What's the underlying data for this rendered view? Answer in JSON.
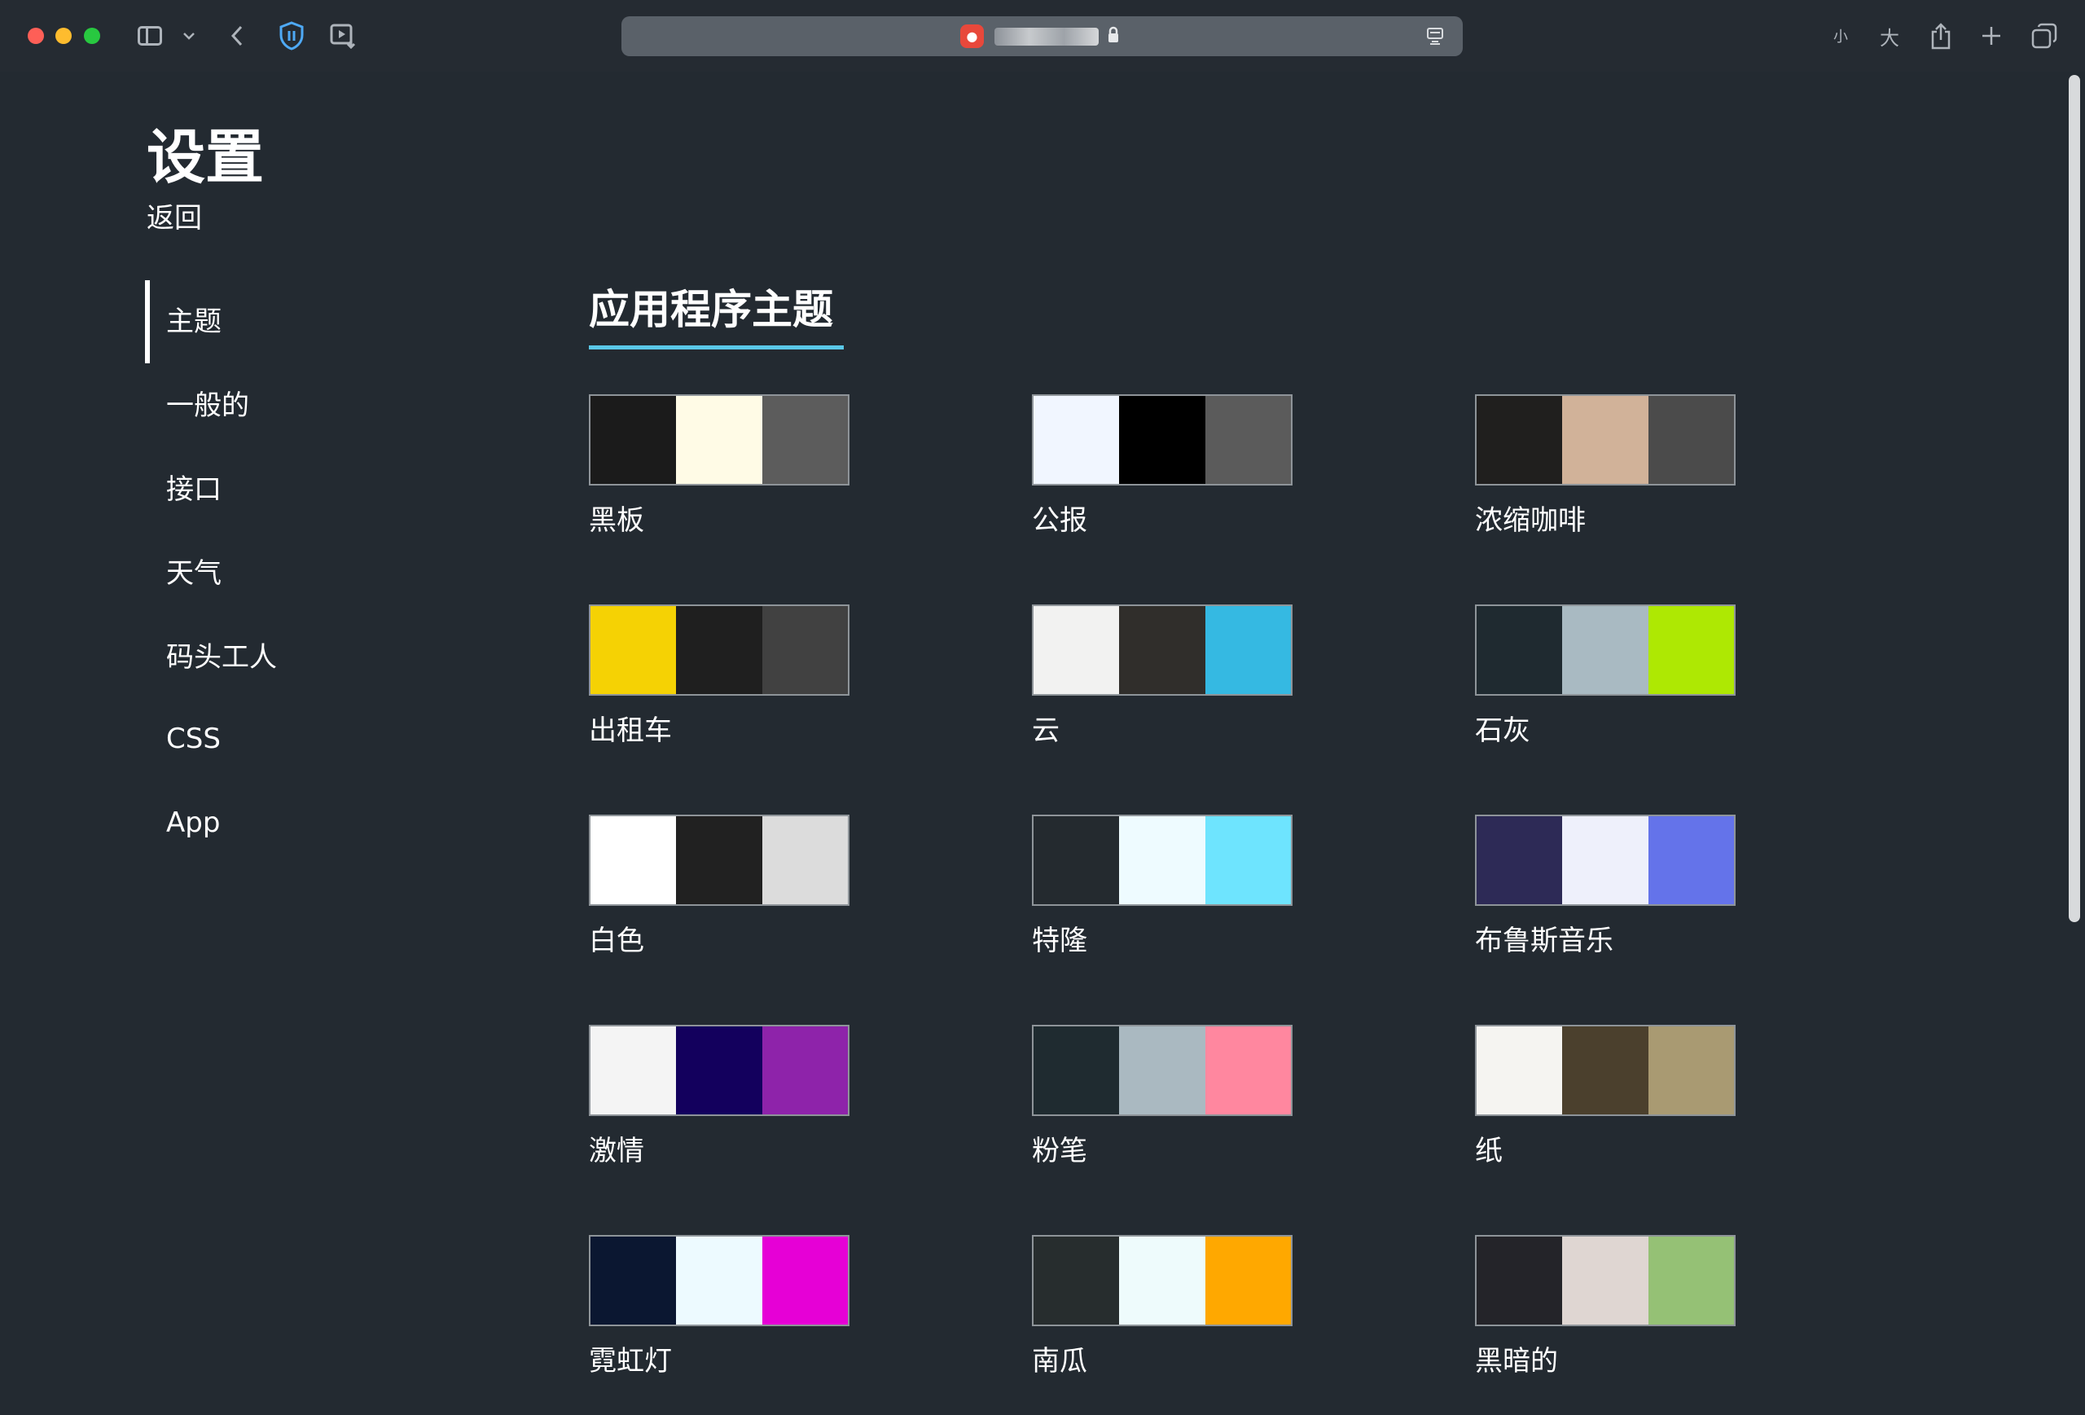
{
  "browser": {
    "font_small_label": "小",
    "font_large_label": "大"
  },
  "page": {
    "title": "设置",
    "back_label": "返回"
  },
  "nav": {
    "items": [
      {
        "label": "主题",
        "active": true
      },
      {
        "label": "一般的",
        "active": false
      },
      {
        "label": "接口",
        "active": false
      },
      {
        "label": "天气",
        "active": false
      },
      {
        "label": "码头工人",
        "active": false
      },
      {
        "label": "CSS",
        "active": false
      },
      {
        "label": "App",
        "active": false
      }
    ]
  },
  "section": {
    "title": "应用程序主题",
    "accent_color": "#5ac8e8"
  },
  "themes": [
    {
      "name": "黑板",
      "colors": [
        "#1b1b1b",
        "#fffbe6",
        "#5c5c5c"
      ]
    },
    {
      "name": "公报",
      "colors": [
        "#f1f6ff",
        "#000000",
        "#5b5b5b"
      ]
    },
    {
      "name": "浓缩咖啡",
      "colors": [
        "#201f1e",
        "#d1b299",
        "#4b4b4b"
      ]
    },
    {
      "name": "出租车",
      "colors": [
        "#f5d204",
        "#1f1f1f",
        "#414141"
      ]
    },
    {
      "name": "云",
      "colors": [
        "#f2f2f1",
        "#302e2b",
        "#35b9e2"
      ]
    },
    {
      "name": "石灰",
      "colors": [
        "#1f2a30",
        "#a9bac2",
        "#aee803"
      ]
    },
    {
      "name": "白色",
      "colors": [
        "#ffffff",
        "#212121",
        "#dcdcdc"
      ]
    },
    {
      "name": "特隆",
      "colors": [
        "#242a2f",
        "#eefbff",
        "#6ee4fe"
      ]
    },
    {
      "name": "布鲁斯音乐",
      "colors": [
        "#2d2a56",
        "#eef0fb",
        "#6473ea"
      ]
    },
    {
      "name": "激情",
      "colors": [
        "#f4f4f4",
        "#13005d",
        "#8e23aa"
      ]
    },
    {
      "name": "粉笔",
      "colors": [
        "#1f2b30",
        "#aab9c1",
        "#ff879f"
      ]
    },
    {
      "name": "纸",
      "colors": [
        "#f5f4f1",
        "#4b402d",
        "#a99a72"
      ]
    },
    {
      "name": "霓虹灯",
      "colors": [
        "#0b1731",
        "#edfaff",
        "#e600d6"
      ]
    },
    {
      "name": "南瓜",
      "colors": [
        "#272d2e",
        "#eefbfc",
        "#ffa800"
      ]
    },
    {
      "name": "黑暗的",
      "colors": [
        "#242429",
        "#dfd6d2",
        "#95c175"
      ]
    }
  ]
}
